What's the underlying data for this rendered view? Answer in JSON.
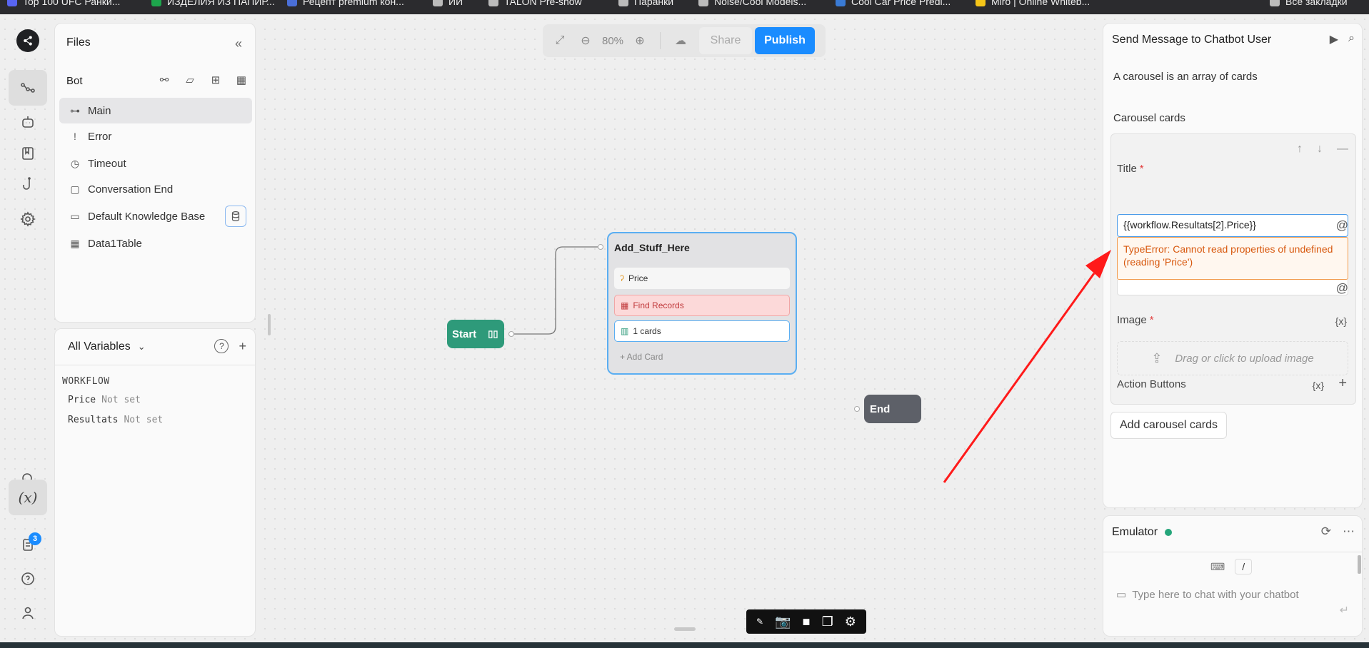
{
  "browser_bookmarks": [
    {
      "label": "Top 100 UFC Ранки...",
      "color": "#5865f2"
    },
    {
      "label": "ИЗДЕЛИЯ ИЗ ПАПИР...",
      "color": "#1da54c"
    },
    {
      "label": "Рецепт premium кон...",
      "color": "#4a6fd8"
    },
    {
      "label": "ИИ",
      "color": "#bbbbbb"
    },
    {
      "label": "TALON Pre-show",
      "color": "#bbbbbb"
    },
    {
      "label": "Паранки",
      "color": "#bbbbbb"
    },
    {
      "label": "Noise/Cool Models...",
      "color": "#bbbbbb"
    },
    {
      "label": "Cool Car Price Predi...",
      "color": "#3a7bd5"
    },
    {
      "label": "Miro | Online Whiteb...",
      "color": "#f5c518"
    },
    {
      "label": "Все закладки",
      "color": "#bbbbbb"
    }
  ],
  "rail": {
    "badge_count": "3"
  },
  "files": {
    "header": "Files",
    "bot_label": "Bot",
    "items": [
      {
        "label": "Main",
        "icon": "⊶"
      },
      {
        "label": "Error",
        "icon": "!"
      },
      {
        "label": "Timeout",
        "icon": "◷"
      },
      {
        "label": "Conversation End",
        "icon": "▢"
      },
      {
        "label": "Default Knowledge Base",
        "icon": "▭"
      },
      {
        "label": "Data1Table",
        "icon": "▦"
      }
    ]
  },
  "variables": {
    "header": "All Variables",
    "group": "WORKFLOW",
    "items": [
      {
        "name": "Price",
        "value": "Not set"
      },
      {
        "name": "Resultats",
        "value": "Not set"
      }
    ]
  },
  "toolbar": {
    "zoom": "80%",
    "share": "Share",
    "publish": "Publish"
  },
  "flow": {
    "start_label": "Start",
    "end_label": "End",
    "node": {
      "title": "Add_Stuff_Here",
      "cards": [
        "Price",
        "Find Records",
        "1 cards"
      ],
      "add_card": "+ Add Card"
    }
  },
  "right_panel": {
    "title": "Send Message to Chatbot User",
    "description": "A carousel is an array of cards",
    "carousel_label": "Carousel cards",
    "title_label": "Title",
    "title_value": "{{workflow.Resultats[2].Price}}",
    "error": "TypeError: Cannot read properties of undefined (reading 'Price')",
    "image_label": "Image",
    "upload_text": "Drag or click to upload image",
    "action_buttons_label": "Action Buttons",
    "x_token": "{x}",
    "add_carousel": "Add carousel cards",
    "accent_color": "#1a8cff",
    "error_color": "#d8590f"
  },
  "emulator": {
    "title": "Emulator",
    "slash": "/",
    "placeholder": "Type here to chat with your chatbot"
  }
}
